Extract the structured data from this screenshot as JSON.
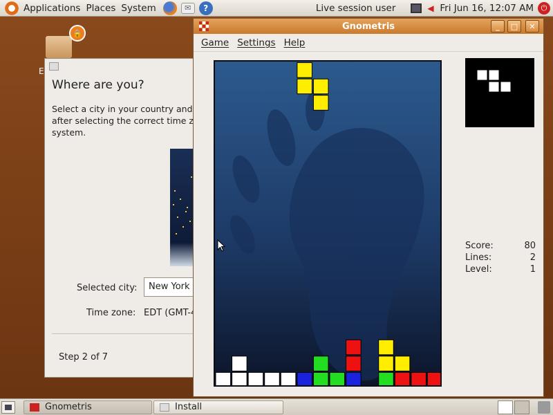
{
  "top_panel": {
    "menus": [
      "Applications",
      "Places",
      "System"
    ],
    "session_user": "Live session user",
    "clock": "Fri Jun 16, 12:07 AM"
  },
  "desktop": {
    "icon_label": "E"
  },
  "installer": {
    "heading": "Where are you?",
    "description": "Select a city in your country and\nafter selecting the correct time z\nsystem.",
    "selected_city_label": "Selected city:",
    "selected_city_value": "New York",
    "time_zone_label": "Time zone:",
    "time_zone_value": "EDT (GMT-4",
    "step": "Step 2 of 7"
  },
  "gnometris": {
    "window_title": "Gnometris",
    "menu": [
      "Game",
      "Settings",
      "Help"
    ],
    "stats": {
      "score_label": "Score:",
      "score_value": "80",
      "lines_label": "Lines:",
      "lines_value": "2",
      "level_label": "Level:",
      "level_value": "1"
    },
    "colors": {
      "white": "#ffffff",
      "yellow": "#ffee00",
      "green": "#22dd22",
      "red": "#ee1111",
      "blue": "#1a22dd"
    },
    "board": {
      "cols": 14,
      "rows": 20,
      "falling_piece": {
        "color": "yellow",
        "cells": [
          [
            5,
            0
          ],
          [
            5,
            1
          ],
          [
            6,
            1
          ],
          [
            6,
            2
          ]
        ]
      },
      "stack": [
        {
          "color": "white",
          "cells": [
            [
              1,
              18
            ],
            [
              0,
              19
            ],
            [
              1,
              19
            ],
            [
              2,
              19
            ],
            [
              3,
              19
            ],
            [
              4,
              19
            ]
          ]
        },
        {
          "color": "blue",
          "cells": [
            [
              5,
              19
            ],
            [
              8,
              19
            ]
          ]
        },
        {
          "color": "green",
          "cells": [
            [
              6,
              18
            ],
            [
              6,
              19
            ],
            [
              7,
              19
            ],
            [
              10,
              19
            ]
          ]
        },
        {
          "color": "red",
          "cells": [
            [
              8,
              17
            ],
            [
              8,
              18
            ],
            [
              11,
              19
            ],
            [
              12,
              19
            ],
            [
              13,
              19
            ]
          ]
        },
        {
          "color": "yellow",
          "cells": [
            [
              10,
              17
            ],
            [
              10,
              18
            ],
            [
              11,
              18
            ]
          ]
        }
      ]
    },
    "next_piece": {
      "color": "white",
      "cells": [
        [
          0,
          0
        ],
        [
          1,
          0
        ],
        [
          1,
          1
        ],
        [
          2,
          1
        ]
      ]
    }
  },
  "taskbar": {
    "tasks": [
      "Gnometris",
      "Install"
    ]
  }
}
